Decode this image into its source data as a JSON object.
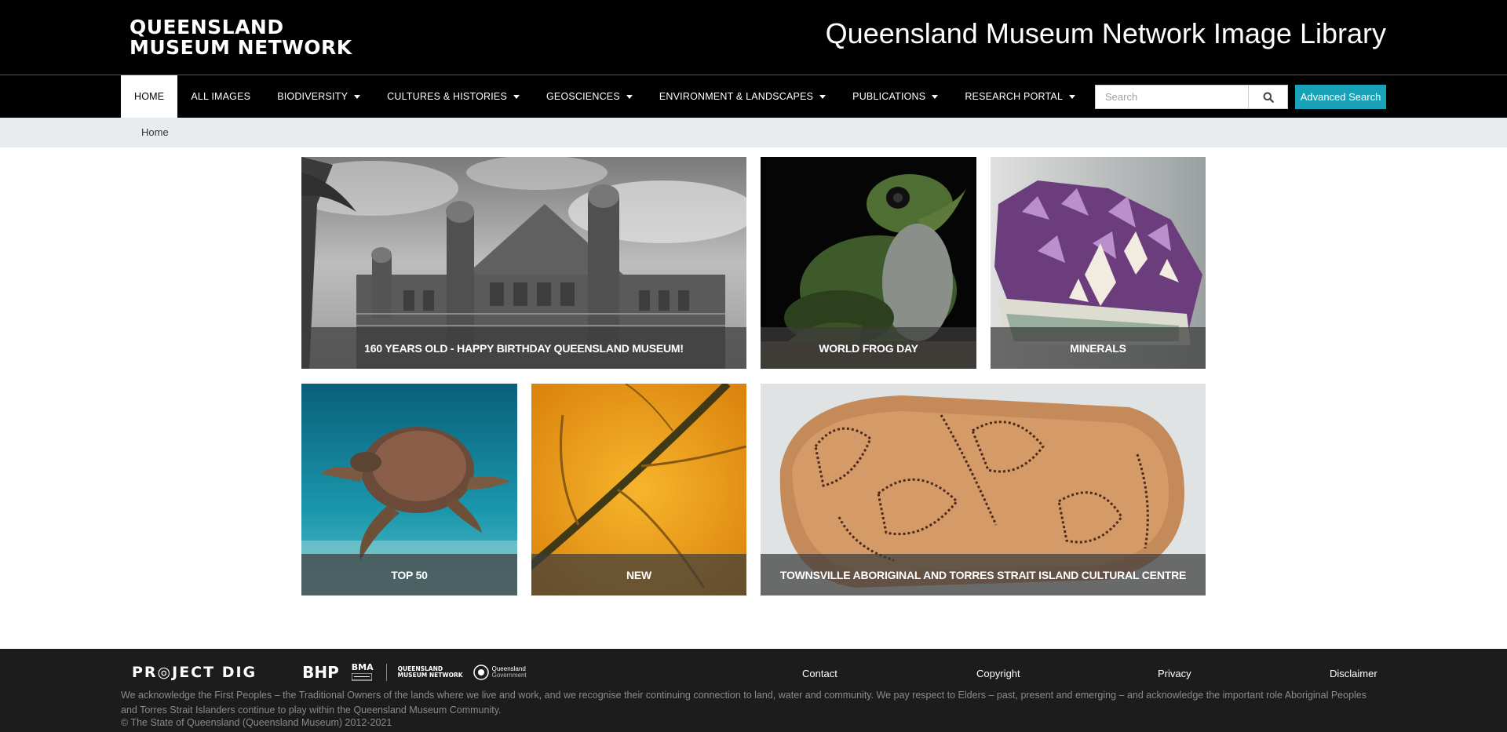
{
  "header": {
    "logo_line1": "QUEENSLAND",
    "logo_line2": "MUSEUM NETWORK",
    "site_title": "Queensland Museum Network Image Library"
  },
  "nav": {
    "items": [
      {
        "label": "HOME",
        "active": true,
        "dropdown": false
      },
      {
        "label": "ALL IMAGES",
        "active": false,
        "dropdown": false
      },
      {
        "label": "BIODIVERSITY",
        "active": false,
        "dropdown": true
      },
      {
        "label": "CULTURES & HISTORIES",
        "active": false,
        "dropdown": true
      },
      {
        "label": "GEOSCIENCES",
        "active": false,
        "dropdown": true
      },
      {
        "label": "ENVIRONMENT & LANDSCAPES",
        "active": false,
        "dropdown": true
      },
      {
        "label": "PUBLICATIONS",
        "active": false,
        "dropdown": true
      },
      {
        "label": "RESEARCH PORTAL",
        "active": false,
        "dropdown": true
      }
    ],
    "search_placeholder": "Search",
    "search_value": "",
    "advanced_search_label": "Advanced Search",
    "accent_color": "#17a2b8"
  },
  "breadcrumb": {
    "items": [
      "Home"
    ]
  },
  "tiles": [
    {
      "caption": "160 YEARS OLD - HAPPY BIRTHDAY QUEENSLAND MUSEUM!"
    },
    {
      "caption": "WORLD FROG DAY"
    },
    {
      "caption": "MINERALS"
    },
    {
      "caption": "TOP 50"
    },
    {
      "caption": "NEW"
    },
    {
      "caption": "TOWNSVILLE ABORIGINAL AND TORRES STRAIT ISLAND CULTURAL CENTRE"
    }
  ],
  "footer": {
    "partner_project_dig": "PR◎JECT DIG",
    "partner_bhp": "BHP",
    "partner_bma": "BMA",
    "partner_qmn_line1": "QUEENSLAND",
    "partner_qmn_line2": "MUSEUM NETWORK",
    "partner_qg_line1": "Queensland",
    "partner_qg_line2": "Government",
    "links": [
      "Contact",
      "Copyright",
      "Privacy",
      "Disclaimer"
    ],
    "acknowledgement": "We acknowledge the First Peoples – the Traditional Owners of the lands where we live and work, and we recognise their continuing connection to land, water and community. We pay respect to Elders – past, present and emerging – and acknowledge the important role Aboriginal Peoples and Torres Strait Islanders continue to play within the Queensland Museum Community.",
    "copyright": "© The State of Queensland (Queensland Museum) 2012-2021"
  }
}
